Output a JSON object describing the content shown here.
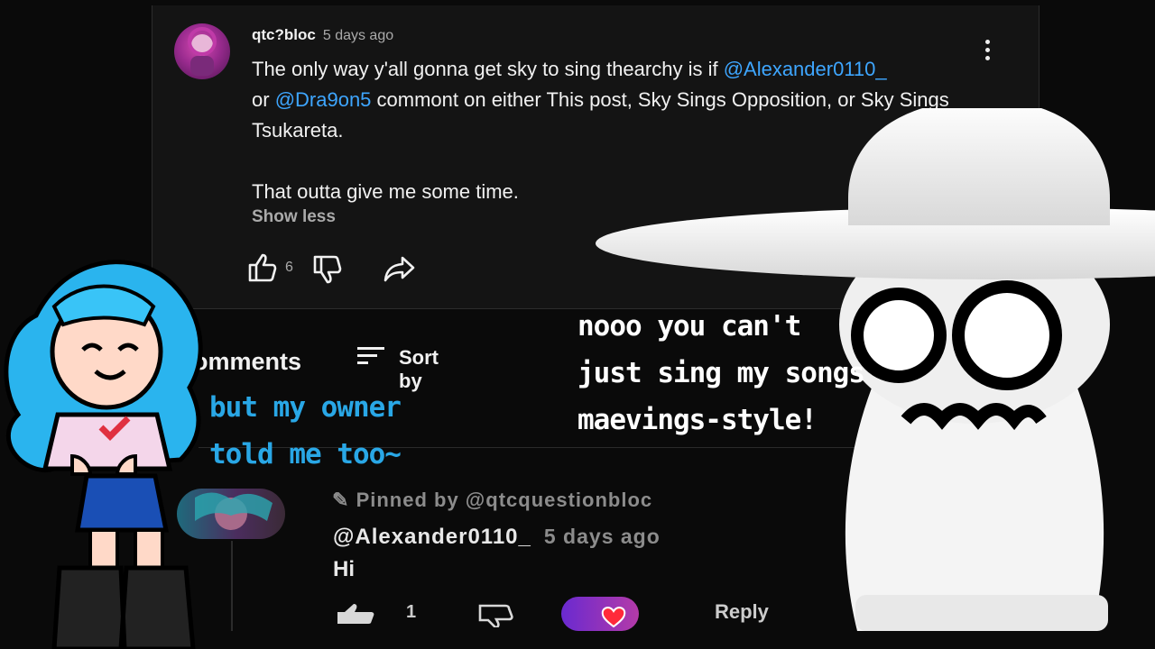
{
  "comment": {
    "author": "qtc?bloc",
    "time": "5 days ago",
    "text_parts": {
      "a": "The only way y'all gonna get sky to sing thearchy is if ",
      "mention1": "@Alexander0110_",
      "b": "or ",
      "mention2": "@Dra9on5",
      "c": "  commont on either This post, Sky Sings Opposition, or Sky Sings Tsukareta.",
      "d": "That outta give me some time."
    },
    "show_less": "Show less",
    "like_count": "6"
  },
  "comments_header": {
    "title": "omments",
    "sort_label": "Sort by"
  },
  "reply": {
    "pinned": "Pinned by @qtcquestionbloc",
    "author": "@Alexander0110_",
    "time": "5 days ago",
    "text": "Hi",
    "like_count": "1",
    "reply_label": "Reply"
  },
  "captions": {
    "white": [
      "nooo you can't",
      "just sing my songs",
      "maevings-style!"
    ],
    "blue": [
      "but my owner",
      "told me too~"
    ]
  },
  "colors": {
    "background": "#0a0a0a",
    "card": "#141414",
    "mention": "#3ea6ff",
    "blue_caption": "#29a7e6"
  }
}
